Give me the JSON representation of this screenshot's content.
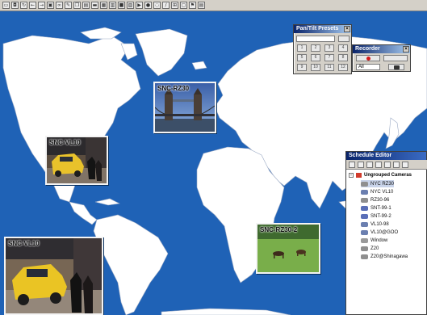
{
  "toolbar": {
    "buttons": [
      "open-icon",
      "camera-icon",
      "rotate-icon",
      "back-icon",
      "forward-icon",
      "monitor-icon",
      "binoculars-icon",
      "brush-icon",
      "copy-icon",
      "paste-icon",
      "folder-icon",
      "picture-icon",
      "calendar-icon",
      "save-icon",
      "print-icon",
      "play-icon",
      "record-icon",
      "chat-icon",
      "pen-icon",
      "grid-icon",
      "window-icon",
      "flag-icon",
      "layout-icon"
    ]
  },
  "cameras": {
    "tl": {
      "label": "SNC-VL10"
    },
    "london": {
      "label": "SNC-RZ30"
    },
    "bl": {
      "label": "SNC-VL10"
    },
    "field": {
      "label": "SNC-RZ30-2"
    }
  },
  "pantilt": {
    "title": "Pan/Tilt Presets",
    "keys": [
      "1",
      "2",
      "3",
      "4",
      "5",
      "6",
      "7",
      "8",
      "9",
      "10",
      "11",
      "12"
    ]
  },
  "recorder": {
    "title": "Recorder",
    "select_value": "All"
  },
  "schedule": {
    "title": "Schedule Editor",
    "root": "Ungrouped Cameras",
    "items": [
      "NYC RZ30",
      "NYC VL10",
      "RZ30-96",
      "SNT-99-1",
      "SNT-99-2",
      "VL10-98",
      "VL10@GOO",
      "Window",
      "Z20",
      "Z20@Shinagawa"
    ]
  },
  "colors": {
    "ocean": "#1f62b6",
    "land": "#ffffff",
    "titlebar": "#0a246a"
  }
}
